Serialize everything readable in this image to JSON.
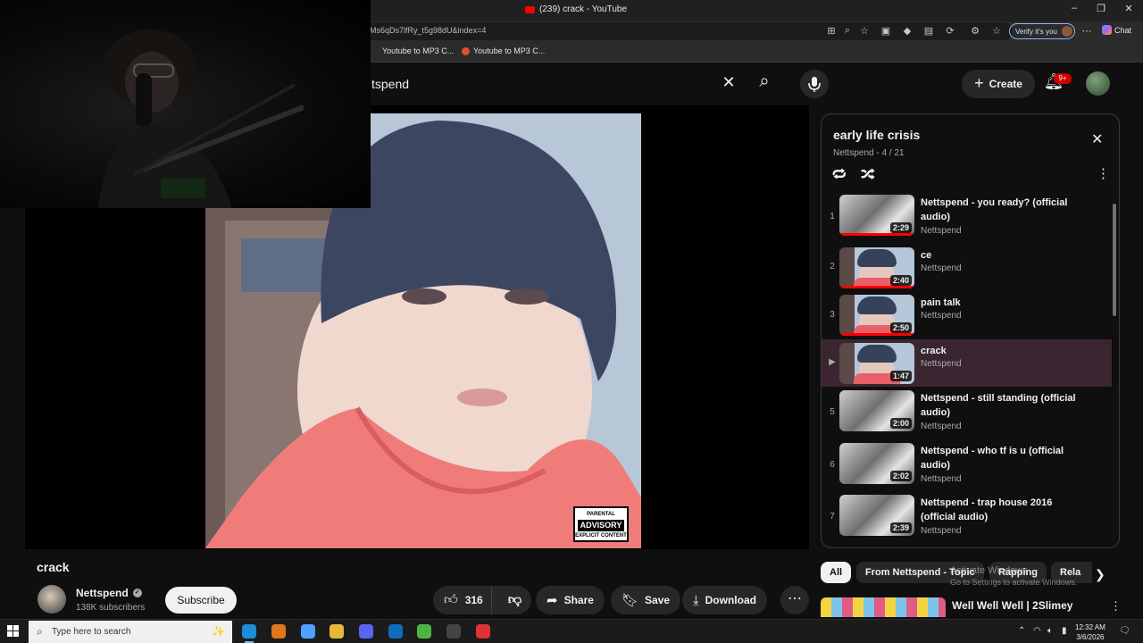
{
  "browser": {
    "tab_title": "(239) crack - YouTube",
    "url": "Ms6qDs7lfRy_t5g98dU&index=4",
    "verify_label": "Verify it's you",
    "copilot_label": "Chat",
    "bookmarks": [
      {
        "label": "Youtube to MP3 C..."
      },
      {
        "label": "Youtube to MP3 C..."
      }
    ]
  },
  "youtube": {
    "search_value": "tspend",
    "create_label": "Create",
    "notification_count": "9+"
  },
  "video": {
    "title": "crack",
    "channel": "Nettspend",
    "subscribers": "138K subscribers",
    "subscribe_label": "Subscribe",
    "likes": "316",
    "share_label": "Share",
    "save_label": "Save",
    "download_label": "Download",
    "advisory_top": "PARENTAL",
    "advisory_main": "ADVISORY",
    "advisory_bottom": "EXPLICIT CONTENT"
  },
  "playlist": {
    "title": "early life crisis",
    "meta": "Nettspend - 4 / 21",
    "items": [
      {
        "index": "1",
        "title": "Nettspend - you ready? (official audio)",
        "channel": "Nettspend",
        "duration": "2:29",
        "thumb": "crowd",
        "watched": 1.0
      },
      {
        "index": "2",
        "title": "ce",
        "channel": "Nettspend",
        "duration": "2:40",
        "thumb": "kid",
        "watched": 1.0
      },
      {
        "index": "3",
        "title": "pain talk",
        "channel": "Nettspend",
        "duration": "2:50",
        "thumb": "kid",
        "watched": 1.0
      },
      {
        "index": "▶",
        "title": "crack",
        "channel": "Nettspend",
        "duration": "1:47",
        "thumb": "kid",
        "watched": 0.0
      },
      {
        "index": "5",
        "title": "Nettspend - still standing (official audio)",
        "channel": "Nettspend",
        "duration": "2:00",
        "thumb": "crowd",
        "watched": 0.0
      },
      {
        "index": "6",
        "title": "Nettspend - who tf is u (official audio)",
        "channel": "Nettspend",
        "duration": "2:02",
        "thumb": "crowd",
        "watched": 0.0
      },
      {
        "index": "7",
        "title": "Nettspend - trap house 2016 (official audio)",
        "channel": "Nettspend",
        "duration": "2:39",
        "thumb": "crowd",
        "watched": 0.0
      }
    ]
  },
  "chips": [
    {
      "label": "All",
      "selected": true
    },
    {
      "label": "From Nettspend - Topic",
      "selected": false
    },
    {
      "label": "Rapping",
      "selected": false
    },
    {
      "label": "Rela",
      "selected": false
    }
  ],
  "recommendation": {
    "title": "Well Well Well | 2Slimey"
  },
  "watermark": {
    "line1": "Activate Windows",
    "line2": "Go to Settings to activate Windows."
  },
  "taskbar": {
    "search_placeholder": "Type here to search",
    "time": "12:32 AM",
    "date": "3/6/2026"
  },
  "colors": {
    "accent_red": "#ff0000",
    "now_playing_bg": "#3a2530",
    "page_bg": "#0f0f0f"
  }
}
